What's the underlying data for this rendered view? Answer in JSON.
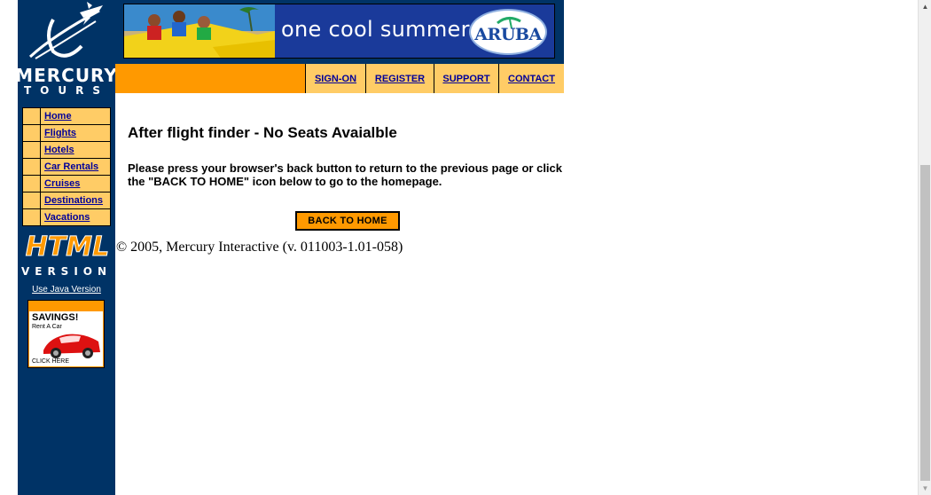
{
  "logo": {
    "line1": "MERCURY",
    "line2": "TOURS"
  },
  "sidebar": {
    "items": [
      {
        "label": "Home"
      },
      {
        "label": "Flights"
      },
      {
        "label": "Hotels"
      },
      {
        "label": "Car Rentals"
      },
      {
        "label": "Cruises"
      },
      {
        "label": "Destinations"
      },
      {
        "label": "Vacations"
      }
    ],
    "badge_line1": "HTML",
    "badge_line2": "VERSION",
    "java_link": "Use Java Version"
  },
  "ad": {
    "title": "SAVINGS!",
    "subtitle": "Rent A Car",
    "cta": "CLICK HERE"
  },
  "banner": {
    "slogan": "one cool summer",
    "brand": "ARUBA"
  },
  "topnav": {
    "items": [
      {
        "label": "SIGN-ON"
      },
      {
        "label": "REGISTER"
      },
      {
        "label": "SUPPORT"
      },
      {
        "label": "CONTACT"
      }
    ]
  },
  "main": {
    "heading": "After flight finder - No Seats Avaialble",
    "message": "Please press your browser's back button to return to the previous page or click the \"BACK TO HOME\" icon below to go to the homepage.",
    "back_button": "BACK TO HOME",
    "copyright": "© 2005, Mercury Interactive (v. 011003-1.01-058)"
  },
  "colors": {
    "navy": "#003366",
    "orange": "#ff9900",
    "nav_bg": "#ffcc66",
    "link": "#000099"
  }
}
